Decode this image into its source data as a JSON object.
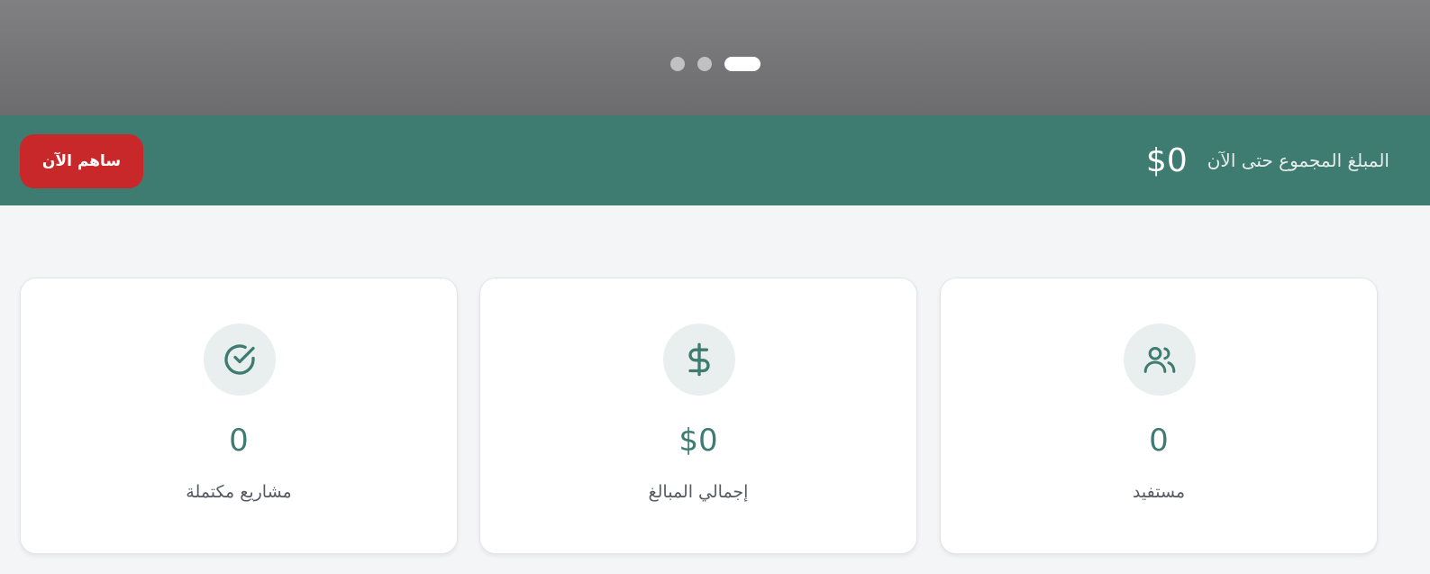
{
  "carousel": {
    "slides": [
      "",
      "",
      ""
    ],
    "active_index": 2
  },
  "banner": {
    "raised_label": "المبلغ المجموع حتى الآن",
    "raised_value": "$0",
    "donate_button": "ساهم الآن"
  },
  "stats": [
    {
      "icon": "users-icon",
      "value": "0",
      "label": "مستفيد"
    },
    {
      "icon": "dollar-icon",
      "value": "$0",
      "label": "إجمالي المبالغ"
    },
    {
      "icon": "check-circle-icon",
      "value": "0",
      "label": "مشاريع مكتملة"
    }
  ],
  "colors": {
    "primary": "#3e7b71",
    "danger": "#c8282a",
    "icon_bg": "#e9efee"
  }
}
